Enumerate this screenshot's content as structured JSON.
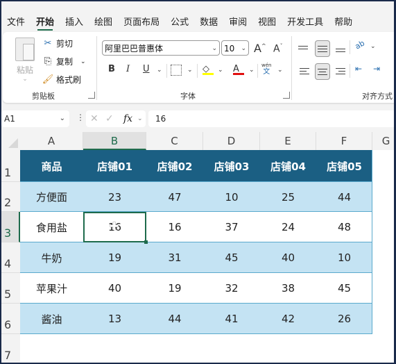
{
  "menu": {
    "tabs": [
      {
        "label": "文件",
        "active": false
      },
      {
        "label": "开始",
        "active": true
      },
      {
        "label": "插入",
        "active": false
      },
      {
        "label": "绘图",
        "active": false
      },
      {
        "label": "页面布局",
        "active": false
      },
      {
        "label": "公式",
        "active": false
      },
      {
        "label": "数据",
        "active": false
      },
      {
        "label": "审阅",
        "active": false
      },
      {
        "label": "视图",
        "active": false
      },
      {
        "label": "开发工具",
        "active": false
      },
      {
        "label": "帮助",
        "active": false
      }
    ]
  },
  "ribbon": {
    "clipboard": {
      "paste_label": "粘贴",
      "cut_label": "剪切",
      "copy_label": "复制",
      "format_painter_label": "格式刷",
      "group_label": "剪贴板"
    },
    "font": {
      "font_name": "阿里巴巴普惠体",
      "font_size": "10",
      "grow_label": "A",
      "shrink_label": "A",
      "bold_label": "B",
      "italic_label": "I",
      "underline_label": "U",
      "phonetic_top": "wén",
      "phonetic_bottom": "文",
      "fill_color": "#ffff00",
      "font_color": "#e01010",
      "group_label": "字体"
    },
    "alignment": {
      "group_label": "对齐方式",
      "orientation_label": "ab"
    }
  },
  "formula_bar": {
    "name_box": "A1",
    "fx_label": "fx",
    "formula": "16"
  },
  "sheet": {
    "columns": [
      "A",
      "B",
      "C",
      "D",
      "E",
      "F",
      "G"
    ],
    "rows": [
      "1",
      "2",
      "3",
      "4",
      "5",
      "6",
      "7"
    ],
    "selected_column": "B",
    "selected_row": "3",
    "header": [
      "商品",
      "店铺01",
      "店铺02",
      "店铺03",
      "店铺04",
      "店铺05"
    ],
    "data": [
      [
        "方便面",
        "23",
        "47",
        "10",
        "25",
        "44"
      ],
      [
        "食用盐",
        "16",
        "16",
        "37",
        "24",
        "48"
      ],
      [
        "牛奶",
        "19",
        "31",
        "45",
        "40",
        "10"
      ],
      [
        "苹果汁",
        "40",
        "19",
        "32",
        "38",
        "45"
      ],
      [
        "酱油",
        "13",
        "44",
        "41",
        "42",
        "26"
      ]
    ],
    "header_color": "#1b5f83",
    "band_color": "#c4e3f3",
    "accent_color": "#1e6b4c"
  }
}
